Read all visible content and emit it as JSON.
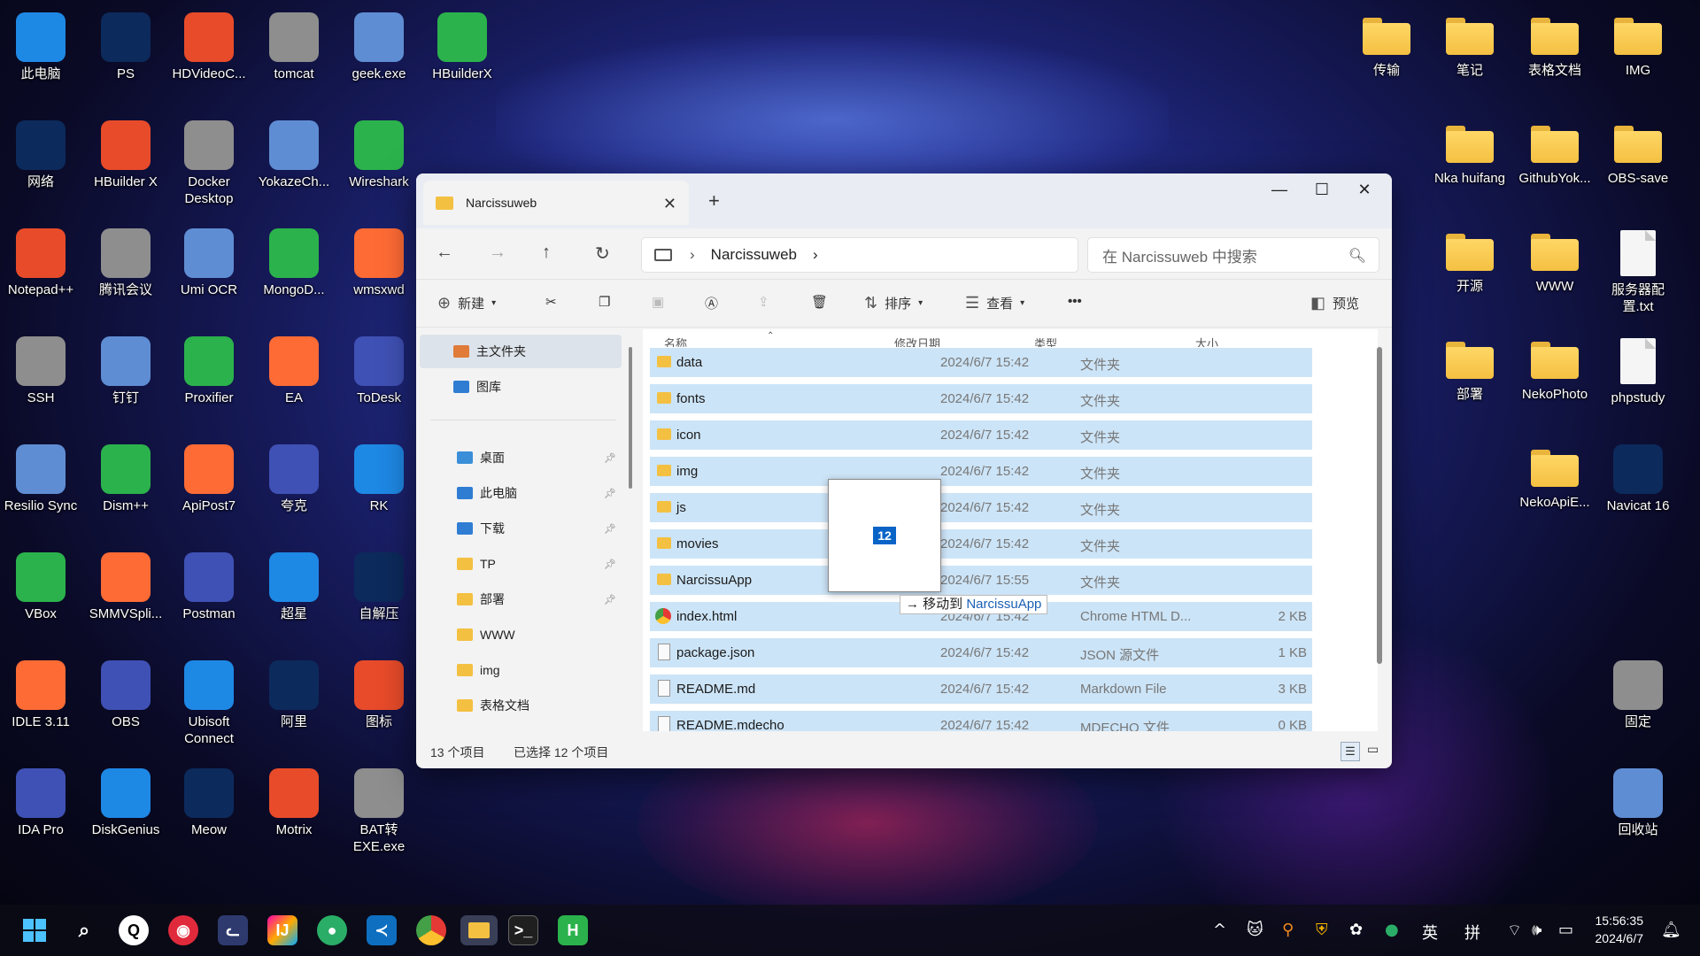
{
  "desktop": {
    "col1": [
      "此电脑",
      "网络",
      "Notepad++",
      "SSH",
      "Resilio Sync",
      "VBox",
      "IDLE 3.11",
      "IDA Pro"
    ],
    "col2": [
      "PS",
      "HBuilder X",
      "腾讯会议",
      "钉钉",
      "Dism++",
      "SMMVSpli...",
      "OBS",
      "DiskGenius"
    ],
    "col3": [
      "HDVideoC...",
      "Docker Desktop",
      "Umi OCR",
      "Proxifier",
      "ApiPost7",
      "Postman",
      "Ubisoft Connect",
      "Meow"
    ],
    "col4": [
      "tomcat",
      "YokazeCh...",
      "MongoD...",
      "EA",
      "夸克",
      "超星",
      "阿里",
      "Motrix"
    ],
    "col5": [
      "geek.exe",
      "Wireshark",
      "wmsxwd",
      "ToDesk",
      "RK",
      "自解压",
      "图标",
      "BAT转 EXE.exe"
    ],
    "col6": [
      "HBuilderX"
    ],
    "right1": [
      "传输",
      "笔记",
      "表格文档",
      "IMG"
    ],
    "right2": [
      "Nka huifang",
      "GithubYok...",
      "OBS-save"
    ],
    "right3": [
      "开源",
      "WWW",
      "服务器配置.txt"
    ],
    "right4": [
      "部署",
      "NekoPhoto",
      "phpstudy"
    ],
    "right5": [
      "NekoApiE...",
      "Navicat 16"
    ],
    "right6": [
      "固定",
      "回收站"
    ],
    "ps_text": "Ps",
    "vs_text": "VS",
    "h_text": "H"
  },
  "window": {
    "tab_title": "Narcissuweb",
    "new_tab": "+",
    "close_tab": "✕",
    "minimize": "—",
    "maximize": "☐",
    "close": "✕",
    "back": "←",
    "forward": "→",
    "up": "↑",
    "refresh": "↻",
    "breadcrumb": "Narcissuweb",
    "chevron": "›",
    "search_placeholder": "在 Narcissuweb 中搜索",
    "toolbar": {
      "new": "新建",
      "sort": "排序",
      "view": "查看",
      "more": "•••",
      "preview": "预览"
    },
    "nav": [
      {
        "label": "主文件夹",
        "selected": true,
        "pinned": false
      },
      {
        "label": "图库",
        "selected": false,
        "pinned": false
      },
      {
        "label": "桌面",
        "selected": false,
        "pinned": true
      },
      {
        "label": "此电脑",
        "selected": false,
        "pinned": true
      },
      {
        "label": "下载",
        "selected": false,
        "pinned": true
      },
      {
        "label": "TP",
        "selected": false,
        "pinned": true
      },
      {
        "label": "部署",
        "selected": false,
        "pinned": true
      },
      {
        "label": "WWW",
        "selected": false,
        "pinned": false
      },
      {
        "label": "img",
        "selected": false,
        "pinned": false
      },
      {
        "label": "表格文档",
        "selected": false,
        "pinned": false
      }
    ],
    "columns": {
      "name": "名称",
      "date": "修改日期",
      "type": "类型",
      "size": "大小"
    },
    "rows": [
      {
        "name": "data",
        "date": "2024/6/7 15:42",
        "type": "文件夹",
        "size": "",
        "icon": "folder"
      },
      {
        "name": "fonts",
        "date": "2024/6/7 15:42",
        "type": "文件夹",
        "size": "",
        "icon": "folder"
      },
      {
        "name": "icon",
        "date": "2024/6/7 15:42",
        "type": "文件夹",
        "size": "",
        "icon": "folder"
      },
      {
        "name": "img",
        "date": "2024/6/7 15:42",
        "type": "文件夹",
        "size": "",
        "icon": "folder"
      },
      {
        "name": "js",
        "date": "2024/6/7 15:42",
        "type": "文件夹",
        "size": "",
        "icon": "folder"
      },
      {
        "name": "movies",
        "date": "2024/6/7 15:42",
        "type": "文件夹",
        "size": "",
        "icon": "folder"
      },
      {
        "name": "NarcissuApp",
        "date": "2024/6/7 15:55",
        "type": "文件夹",
        "size": "",
        "icon": "folder"
      },
      {
        "name": "index.html",
        "date": "2024/6/7 15:42",
        "type": "Chrome HTML D...",
        "size": "2 KB",
        "icon": "chrome"
      },
      {
        "name": "package.json",
        "date": "2024/6/7 15:42",
        "type": "JSON 源文件",
        "size": "1 KB",
        "icon": "doc"
      },
      {
        "name": "README.md",
        "date": "2024/6/7 15:42",
        "type": "Markdown File",
        "size": "3 KB",
        "icon": "doc"
      },
      {
        "name": "README.mdecho",
        "date": "2024/6/7 15:42",
        "type": "MDECHO 文件",
        "size": "0 KB",
        "icon": "doc"
      }
    ],
    "drag": {
      "count": "12",
      "tip_prefix": "→ 移动到 ",
      "tip_target": "NarcissuApp"
    },
    "status": {
      "items": "13 个项目",
      "selected": "已选择 12 个项目"
    }
  },
  "taskbar": {
    "ime1": "英",
    "ime2": "拼",
    "time": "15:56:35",
    "date": "2024/6/7"
  }
}
